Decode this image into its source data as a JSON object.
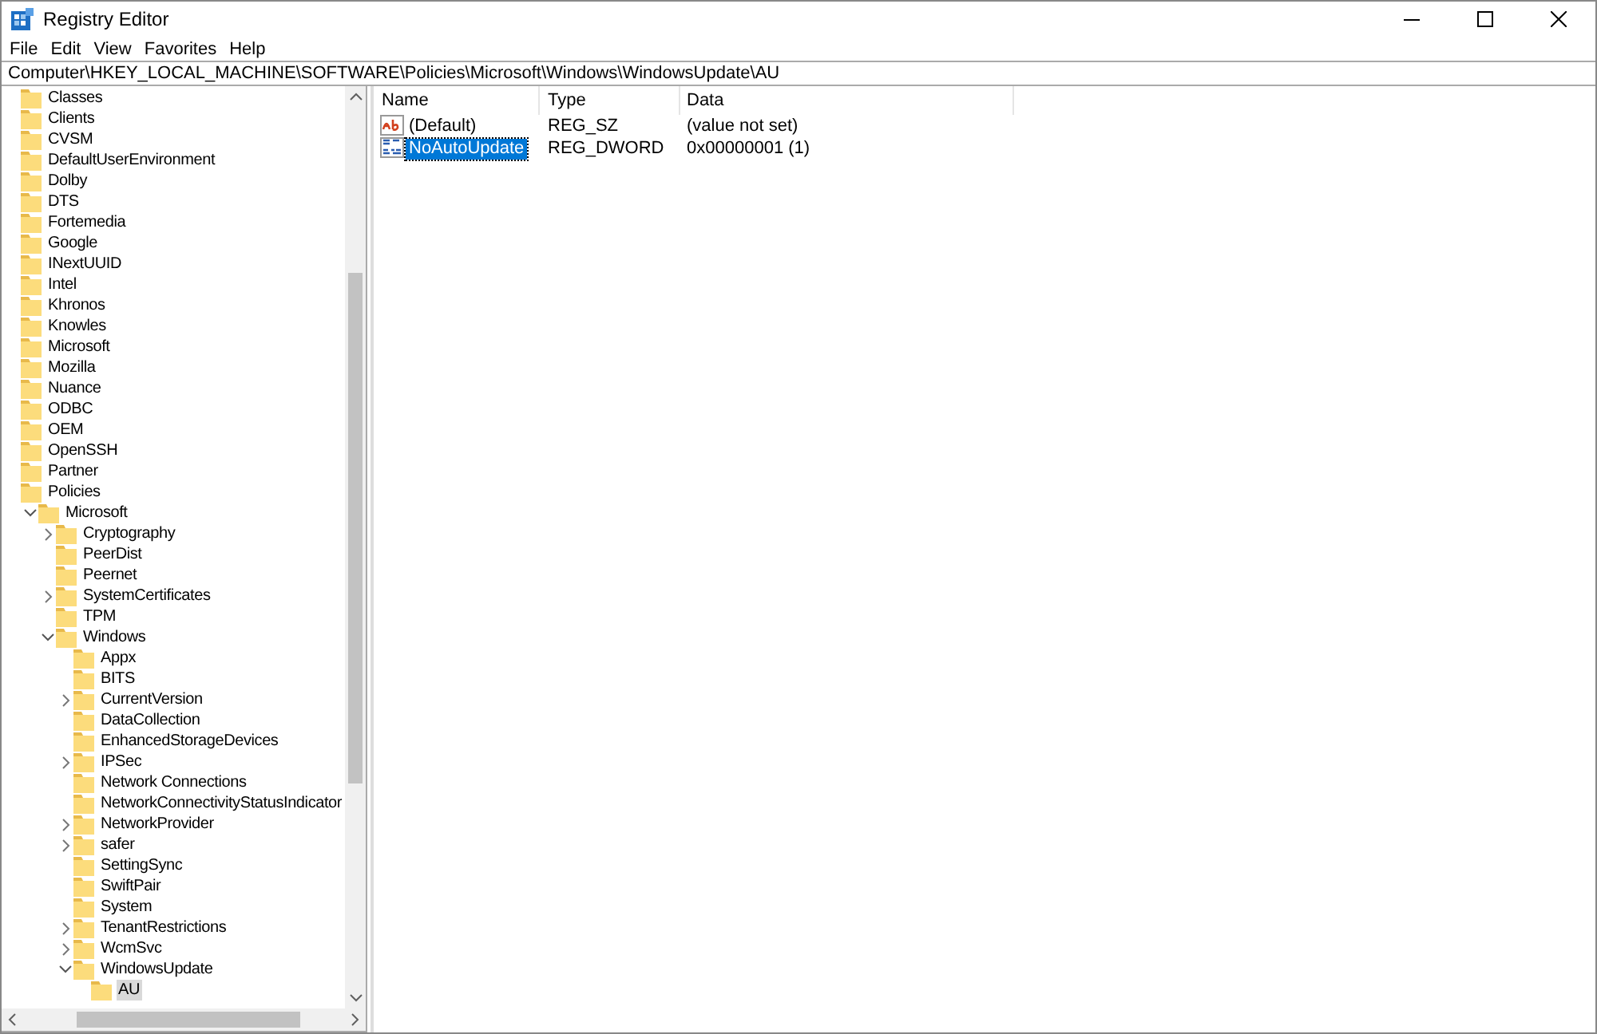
{
  "window": {
    "title": "Registry Editor"
  },
  "menu": [
    "File",
    "Edit",
    "View",
    "Favorites",
    "Help"
  ],
  "address": "Computer\\HKEY_LOCAL_MACHINE\\SOFTWARE\\Policies\\Microsoft\\Windows\\WindowsUpdate\\AU",
  "tree": [
    {
      "label": "Classes",
      "selected": false
    },
    {
      "label": "Clients",
      "selected": false
    },
    {
      "label": "CVSM",
      "selected": false
    },
    {
      "label": "DefaultUserEnvironment",
      "selected": false
    },
    {
      "label": "Dolby",
      "selected": false
    },
    {
      "label": "DTS",
      "selected": false
    },
    {
      "label": "Fortemedia",
      "selected": false
    },
    {
      "label": "Google",
      "selected": false
    },
    {
      "label": "INextUUID",
      "selected": false
    },
    {
      "label": "Intel",
      "selected": false
    },
    {
      "label": "Khronos",
      "selected": false
    },
    {
      "label": "Knowles",
      "selected": false
    },
    {
      "label": "Microsoft",
      "selected": false
    },
    {
      "label": "Mozilla",
      "selected": false
    },
    {
      "label": "Nuance",
      "selected": false
    },
    {
      "label": "ODBC",
      "selected": false
    },
    {
      "label": "OEM",
      "selected": false
    },
    {
      "label": "OpenSSH",
      "selected": false
    },
    {
      "label": "Partner",
      "selected": false
    },
    {
      "label": "Policies",
      "selected": false,
      "children": [
        {
          "label": "Microsoft",
          "selected": false,
          "expanded": true,
          "children": [
            {
              "label": "Cryptography",
              "selected": false,
              "expanded": false
            },
            {
              "label": "PeerDist",
              "selected": false
            },
            {
              "label": "Peernet",
              "selected": false
            },
            {
              "label": "SystemCertificates",
              "selected": false,
              "expanded": false
            },
            {
              "label": "TPM",
              "selected": false
            },
            {
              "label": "Windows",
              "selected": false,
              "expanded": true,
              "children": [
                {
                  "label": "Appx",
                  "selected": false
                },
                {
                  "label": "BITS",
                  "selected": false
                },
                {
                  "label": "CurrentVersion",
                  "selected": false,
                  "expanded": false
                },
                {
                  "label": "DataCollection",
                  "selected": false
                },
                {
                  "label": "EnhancedStorageDevices",
                  "selected": false
                },
                {
                  "label": "IPSec",
                  "selected": false,
                  "expanded": false
                },
                {
                  "label": "Network Connections",
                  "selected": false
                },
                {
                  "label": "NetworkConnectivityStatusIndicator",
                  "selected": false
                },
                {
                  "label": "NetworkProvider",
                  "selected": false,
                  "expanded": false
                },
                {
                  "label": "safer",
                  "selected": false,
                  "expanded": false
                },
                {
                  "label": "SettingSync",
                  "selected": false
                },
                {
                  "label": "SwiftPair",
                  "selected": false
                },
                {
                  "label": "System",
                  "selected": false
                },
                {
                  "label": "TenantRestrictions",
                  "selected": false,
                  "expanded": false
                },
                {
                  "label": "WcmSvc",
                  "selected": false,
                  "expanded": false
                },
                {
                  "label": "WindowsUpdate",
                  "selected": false,
                  "expanded": true,
                  "children": [
                    {
                      "label": "AU",
                      "selected": true
                    }
                  ]
                }
              ]
            }
          ]
        }
      ]
    }
  ],
  "values": {
    "columns": [
      "Name",
      "Type",
      "Data"
    ],
    "rows": [
      {
        "kind": "string",
        "name": "(Default)",
        "type": "REG_SZ",
        "data": "(value not set)",
        "selected": false
      },
      {
        "kind": "binary",
        "name": "NoAutoUpdate",
        "type": "REG_DWORD",
        "data": "0x00000001 (1)",
        "selected": true
      }
    ]
  }
}
